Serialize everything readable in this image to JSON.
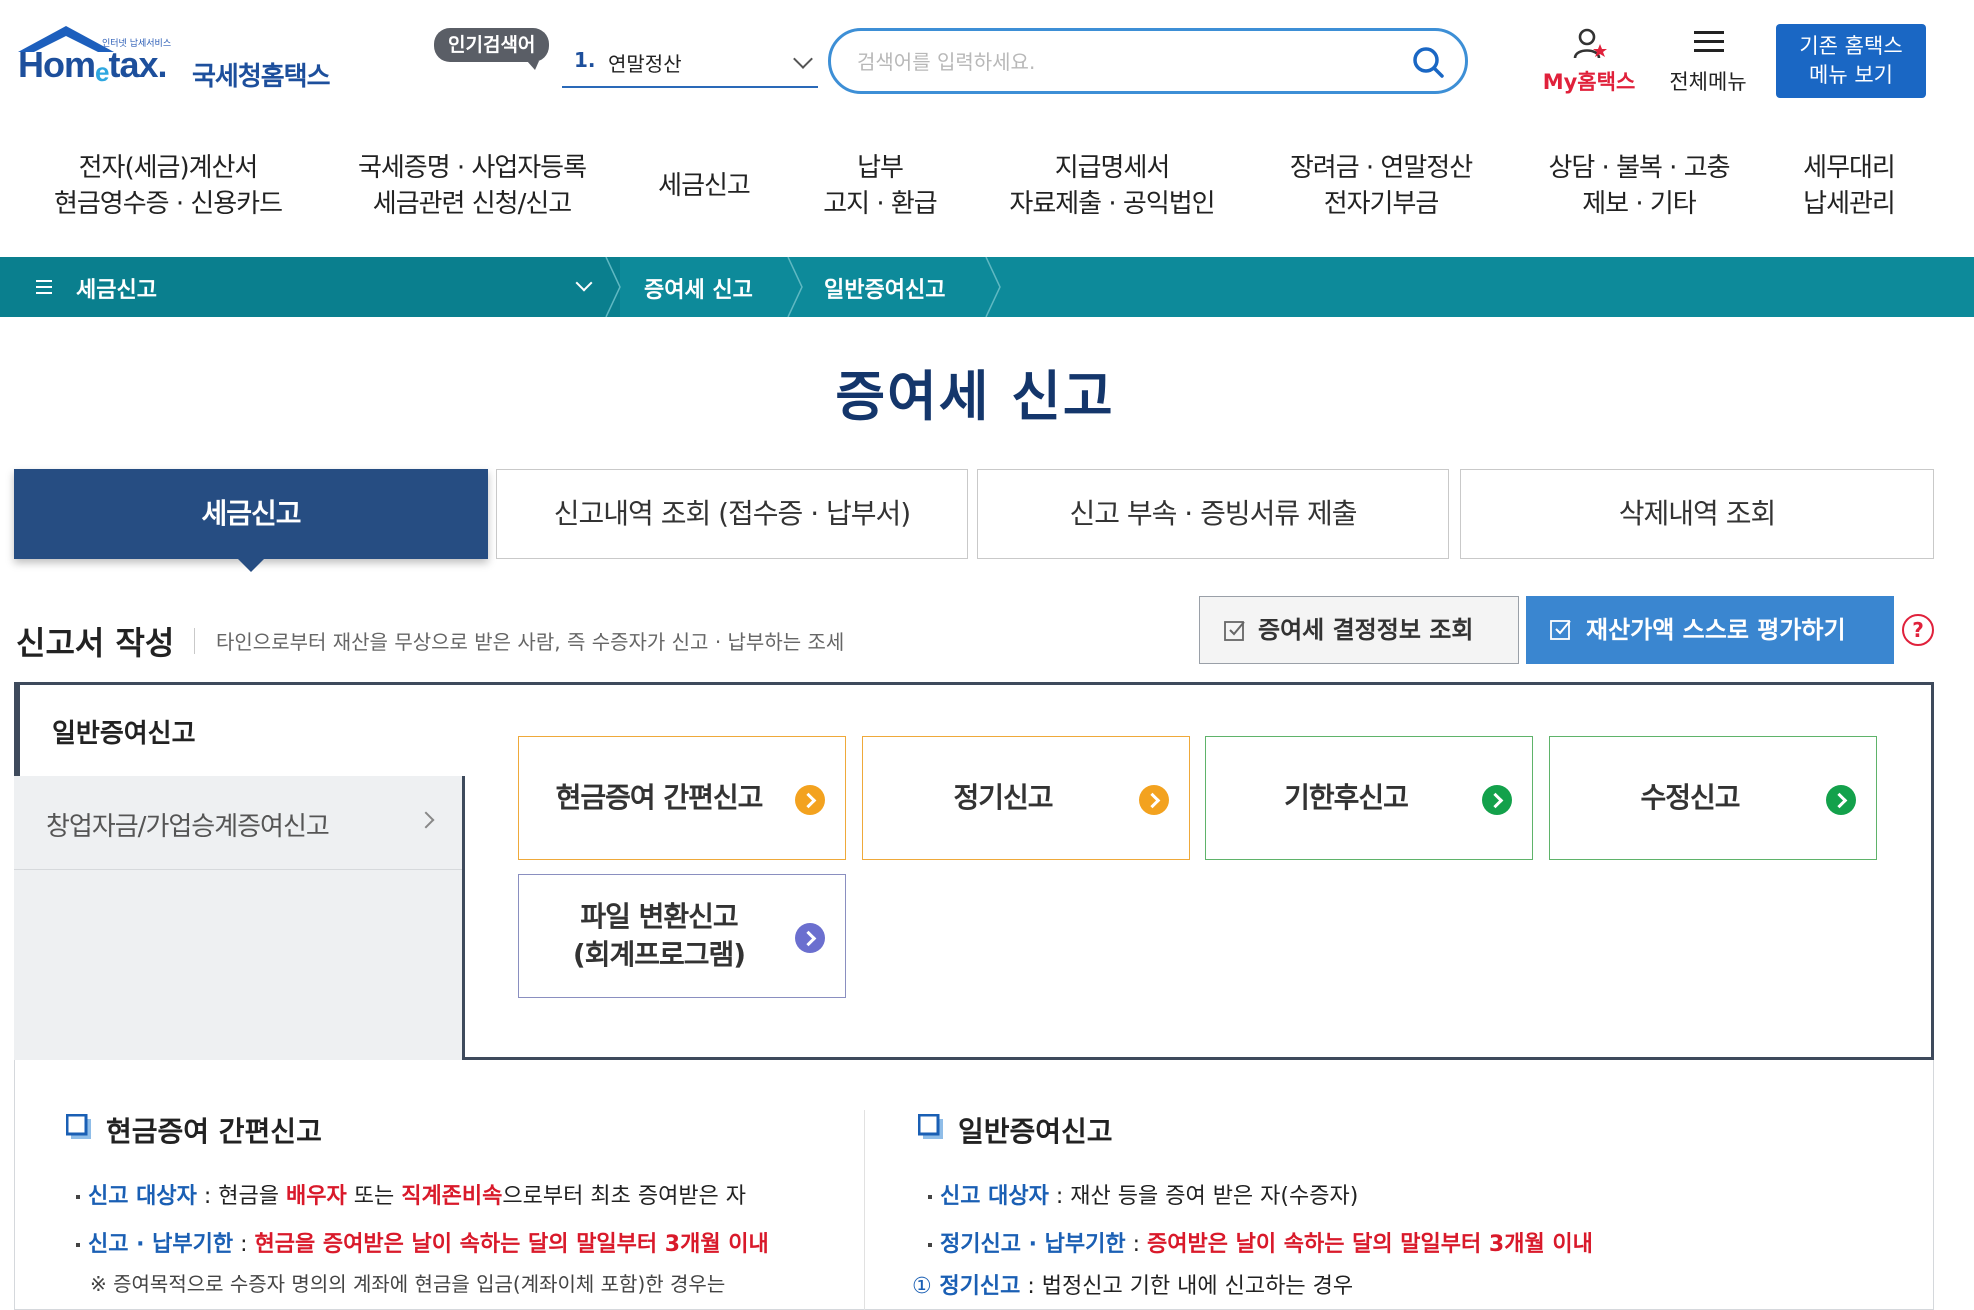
{
  "header": {
    "logo_tagline": "인터넷 납세서비스",
    "logo_word": "Hometax.",
    "logo_word_main": "Hom",
    "logo_word_e": "e",
    "logo_word_tail": "tax",
    "logo_word_dot": ".",
    "logo_kr": "국세청홈택스",
    "popular_badge": "인기검색어",
    "popular_num": "1.",
    "popular_text": "연말정산",
    "search_placeholder": "검색어를 입력하세요.",
    "my_hometax": "My홈택스",
    "all_menu": "전체메뉴",
    "old_menu_line1": "기존 홈택스",
    "old_menu_line2": "메뉴 보기"
  },
  "topnav": [
    {
      "l1": "전자(세금)계산서",
      "l2": "현금영수증 · 신용카드"
    },
    {
      "l1": "국세증명 · 사업자등록",
      "l2": "세금관련 신청/신고"
    },
    {
      "l1": "세금신고",
      "l2": ""
    },
    {
      "l1": "납부",
      "l2": "고지 · 환급"
    },
    {
      "l1": "지급명세서",
      "l2": "자료제출 · 공익법인"
    },
    {
      "l1": "장려금 · 연말정산",
      "l2": "전자기부금"
    },
    {
      "l1": "상담 · 불복 · 고충",
      "l2": "제보 · 기타"
    },
    {
      "l1": "세무대리",
      "l2": "납세관리"
    }
  ],
  "breadcrumb": {
    "home": "세금신고",
    "item1": "증여세 신고",
    "item2": "일반증여신고"
  },
  "page_title": "증여세 신고",
  "tabs": [
    "세금신고",
    "신고내역 조회 (접수증 · 납부서)",
    "신고 부속 · 증빙서류 제출",
    "삭제내역 조회"
  ],
  "section": {
    "title": "신고서 작성",
    "desc": "타인으로부터 재산을 무상으로 받은 사람, 즉 수증자가 신고 · 납부하는 조세",
    "btn_decision": "증여세 결정정보 조회",
    "btn_self": "재산가액 스스로 평가하기",
    "help": "?"
  },
  "side": {
    "active": "일반증여신고",
    "item": "창업자금/가업승계증여신고"
  },
  "options": {
    "o1": "현금증여 간편신고",
    "o2": "정기신고",
    "o3": "기한후신고",
    "o4": "수정신고",
    "o5_l1": "파일 변환신고",
    "o5_l2": "(회계프로그램)"
  },
  "info_left": {
    "head": "현금증여 간편신고",
    "l1_k": "신고 대상자",
    "l1_a": " : 현금을 ",
    "l1_r1": "배우자",
    "l1_b": " 또는 ",
    "l1_r2": "직계존비속",
    "l1_c": "으로부터 최초 증여받은 자",
    "l2_k": "신고 · 납부기한",
    "l2_a": " : ",
    "l2_r": "현금을 증여받은 날이 속하는 달의 말일부터 3개월 이내",
    "l3": "※ 증여목적으로 수증자 명의의 계좌에 현금을 입금(계좌이체 포함)한 경우는"
  },
  "info_right": {
    "head": "일반증여신고",
    "l1_k": "신고 대상자",
    "l1_a": " : 재산 등을 증여 받은 자(수증자)",
    "l2_k": "정기신고 · 납부기한",
    "l2_a": " : ",
    "l2_r": "증여받은 날이 속하는 달의 말일부터 3개월 이내",
    "l3_n": "①",
    "l3_k": " 정기신고",
    "l3_a": " : 법정신고 기한 내에 신고하는 경우"
  },
  "colors": {
    "brand_navy": "#264d82",
    "teal_bar": "#0d8a9a",
    "accent_blue": "#3a86d0",
    "red": "#d9192a",
    "orange": "#f3a21f",
    "green": "#13a14b",
    "purple": "#6b6fcf"
  },
  "icons": [
    "home-roof-icon",
    "chevron-down-icon",
    "search-icon",
    "my-user-icon",
    "hamburger-icon",
    "check-square-icon",
    "help-icon",
    "chevron-right-icon",
    "arrow-circle-icon",
    "square-bullet-icon"
  ]
}
